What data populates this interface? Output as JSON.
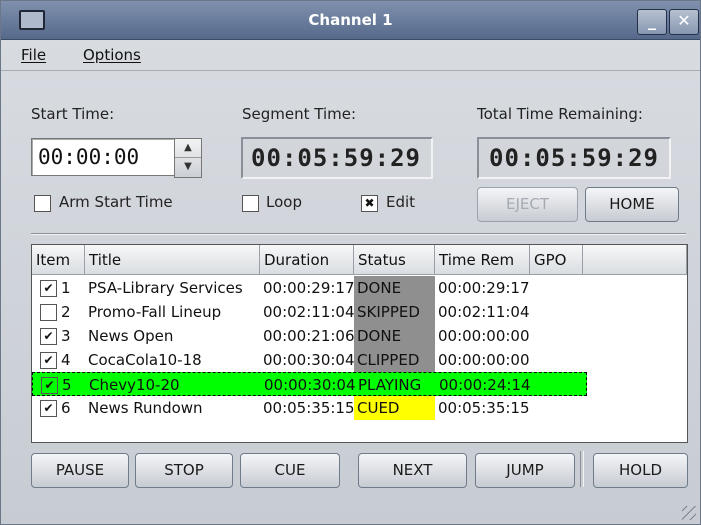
{
  "window": {
    "title": "Channel 1",
    "minimize_label": "_",
    "close_label": "✕"
  },
  "menu": {
    "file": "File",
    "options": "Options"
  },
  "times": {
    "start_label": "Start Time:",
    "start_value": "00:00:00",
    "segment_label": "Segment Time:",
    "segment_value": "00:05:59:29",
    "total_label": "Total Time Remaining:",
    "total_value": "00:05:59:29"
  },
  "options": {
    "arm_start": "Arm Start Time",
    "arm_checked": false,
    "loop": "Loop",
    "loop_checked": false,
    "edit": "Edit",
    "edit_checked": true
  },
  "buttons": {
    "eject": "EJECT",
    "home": "HOME",
    "pause": "PAUSE",
    "stop": "STOP",
    "cue": "CUE",
    "next": "NEXT",
    "jump": "JUMP",
    "hold": "HOLD"
  },
  "table": {
    "headers": [
      "Item",
      "Title",
      "Duration",
      "Status",
      "Time Rem",
      "GPO"
    ],
    "rows": [
      {
        "checked": true,
        "num": "1",
        "title": "PSA-Library Services",
        "duration": "00:00:29:17",
        "status": "DONE",
        "rem": "00:00:29:17"
      },
      {
        "checked": false,
        "num": "2",
        "title": "Promo-Fall Lineup",
        "duration": "00:02:11:04",
        "status": "SKIPPED",
        "rem": "00:02:11:04"
      },
      {
        "checked": true,
        "num": "3",
        "title": "News Open",
        "duration": "00:00:21:06",
        "status": "DONE",
        "rem": "00:00:00:00"
      },
      {
        "checked": true,
        "num": "4",
        "title": "CocaCola10-18",
        "duration": "00:00:30:04",
        "status": "CLIPPED",
        "rem": "00:00:00:00"
      },
      {
        "checked": true,
        "num": "5",
        "title": "Chevy10-20",
        "duration": "00:00:30:04",
        "status": "PLAYING",
        "rem": "00:00:24:14"
      },
      {
        "checked": true,
        "num": "6",
        "title": "News Rundown",
        "duration": "00:05:35:15",
        "status": "CUED",
        "rem": "00:05:35:15"
      }
    ]
  },
  "colors": {
    "done": "#8f8f8f",
    "playing": "#00ff00",
    "cued": "#ffff00"
  }
}
